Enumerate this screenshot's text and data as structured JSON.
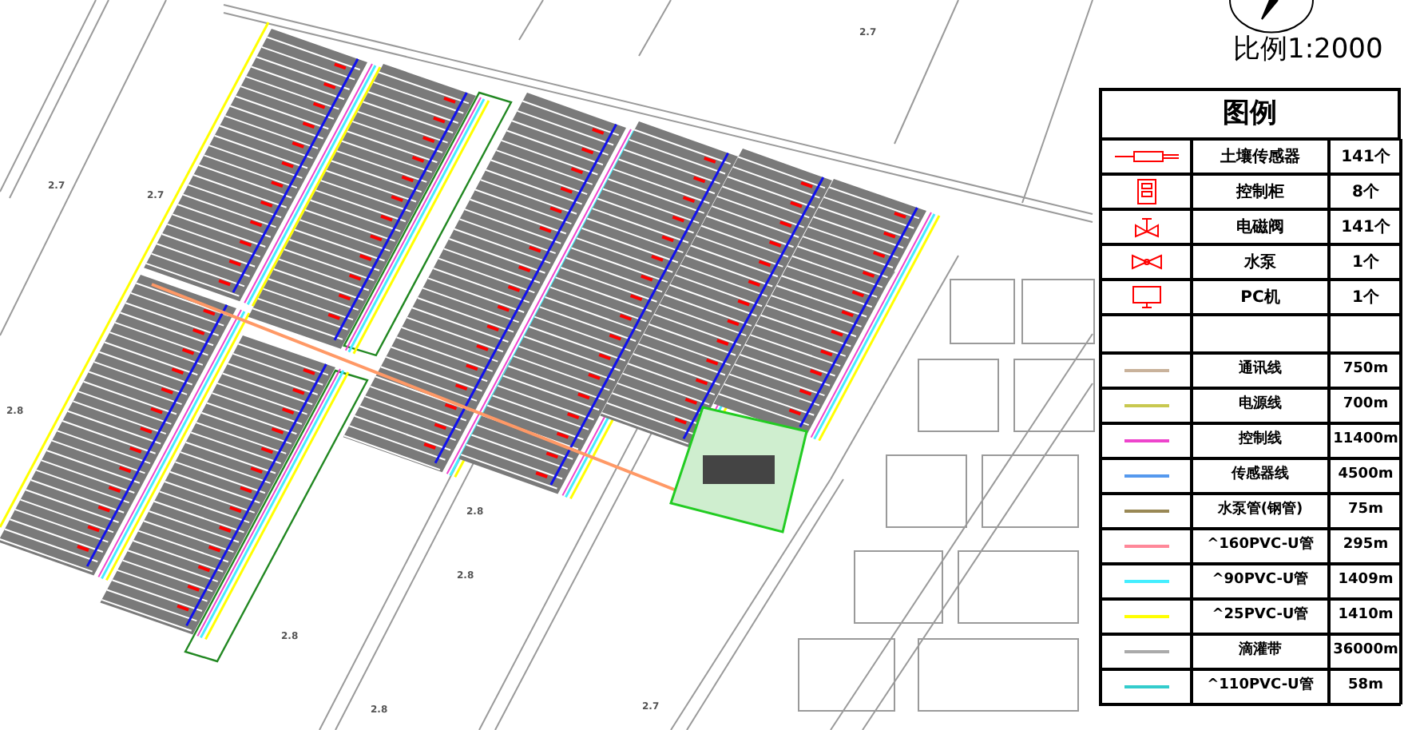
{
  "scale_label": "比例1:2000",
  "legend": {
    "title": "图例",
    "symbols": [
      {
        "kind": "sensor",
        "name": "土壤传感器",
        "count": "141个"
      },
      {
        "kind": "cabinet",
        "name": "控制柜",
        "count": "8个"
      },
      {
        "kind": "valve",
        "name": "电磁阀",
        "count": "141个"
      },
      {
        "kind": "pump",
        "name": "水泵",
        "count": "1个"
      },
      {
        "kind": "pc",
        "name": "PC机",
        "count": "1个"
      }
    ],
    "lines": [
      {
        "name": "通讯线",
        "length": "750m",
        "color": "#c9b29b"
      },
      {
        "name": "电源线",
        "length": "700m",
        "color": "#c8c850"
      },
      {
        "name": "控制线",
        "length": "11400m",
        "color": "#ee44cc"
      },
      {
        "name": "传感器线",
        "length": "4500m",
        "color": "#5599ee"
      },
      {
        "name": "水泵管(钢管)",
        "length": "75m",
        "color": "#998855"
      },
      {
        "name": "^160PVC-U管",
        "length": "295m",
        "color": "#ff8899"
      },
      {
        "name": "^90PVC-U管",
        "length": "1409m",
        "color": "#44eeff"
      },
      {
        "name": "^25PVC-U管",
        "length": "1410m",
        "color": "#ffff00"
      },
      {
        "name": "滴灌带",
        "length": "36000m",
        "color": "#aaaaaa"
      },
      {
        "name": "^110PVC-U管",
        "length": "58m",
        "color": "#33cccc"
      }
    ]
  },
  "map_labels": [
    "2.7",
    "2.7",
    "2.8",
    "2.8",
    "2.8",
    "2.8",
    "2.7",
    "2.8",
    "2.7"
  ]
}
